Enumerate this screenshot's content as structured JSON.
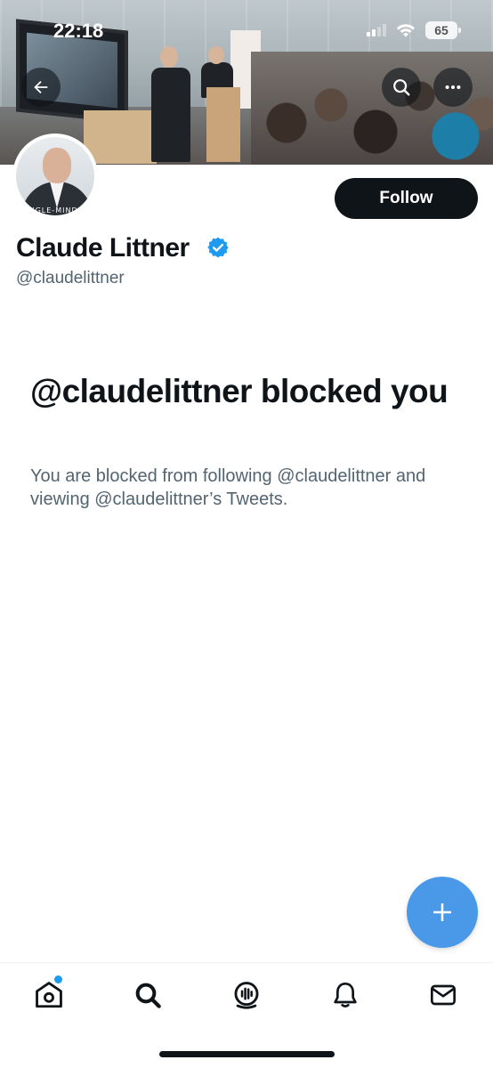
{
  "status_bar": {
    "time": "22:18",
    "battery": "65"
  },
  "header": {
    "back_icon": "arrow-left-icon",
    "search_icon": "search-icon",
    "more_icon": "more-horizontal-icon"
  },
  "profile": {
    "display_name": "Claude Littner",
    "handle": "@claudelittner",
    "verified": true,
    "follow_label": "Follow",
    "avatar_text": "SINGLE-MINDED"
  },
  "blocked": {
    "title": "@claudelittner blocked you",
    "description": "You are blocked from following @claudelittner and viewing @claudelittner’s Tweets."
  },
  "fab": {
    "icon": "plus-icon"
  },
  "bottom_nav": {
    "items": [
      {
        "name": "home",
        "icon": "home-icon",
        "has_badge": true
      },
      {
        "name": "search",
        "icon": "search-icon"
      },
      {
        "name": "spaces",
        "icon": "spaces-icon"
      },
      {
        "name": "notifications",
        "icon": "bell-icon"
      },
      {
        "name": "messages",
        "icon": "mail-icon"
      }
    ]
  },
  "colors": {
    "accent": "#1d9bf0",
    "fab": "#4a99e9",
    "text": "#0f1419",
    "secondary_text": "#536471"
  }
}
